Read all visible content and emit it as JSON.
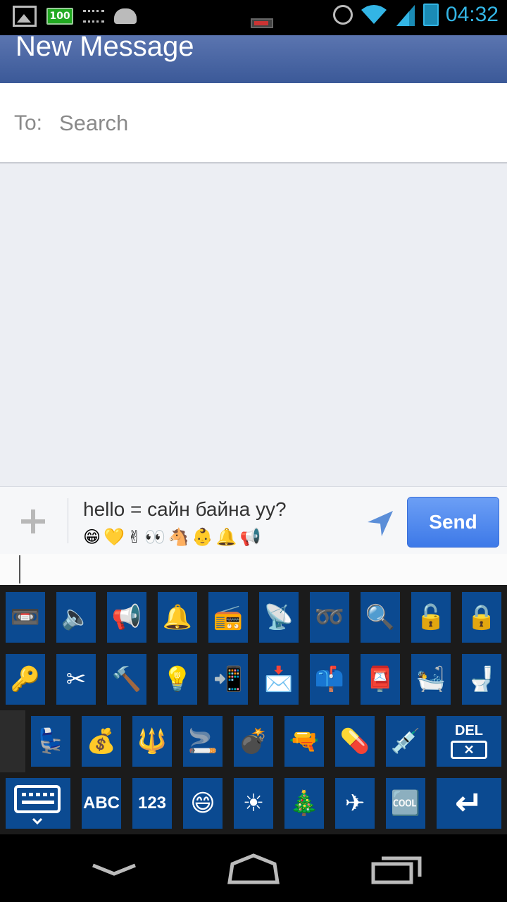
{
  "status_bar": {
    "battery_text": "100",
    "time": "04:32"
  },
  "header": {
    "title": "New Message"
  },
  "to_row": {
    "label": "To:",
    "placeholder": "Search"
  },
  "composer": {
    "message_text": "hello = сайн байна уу?",
    "emojis": [
      "😁",
      "💛",
      "✌",
      "👀",
      "🐴",
      "👶",
      "🔔",
      "📢"
    ],
    "send_label": "Send"
  },
  "keyboard": {
    "row1": [
      {
        "name": "videocassette-key",
        "glyph": "📼"
      },
      {
        "name": "speaker-key",
        "glyph": "🔈"
      },
      {
        "name": "megaphone-key",
        "glyph": "📢"
      },
      {
        "name": "bell-key",
        "glyph": "🔔"
      },
      {
        "name": "radio-key",
        "glyph": "📻"
      },
      {
        "name": "satellite-key",
        "glyph": "📡"
      },
      {
        "name": "loop-key",
        "glyph": "➿"
      },
      {
        "name": "magnifier-key",
        "glyph": "🔍"
      },
      {
        "name": "unlock-key",
        "glyph": "🔓"
      },
      {
        "name": "lock-key",
        "glyph": "🔒"
      }
    ],
    "row2": [
      {
        "name": "key-key",
        "glyph": "🔑"
      },
      {
        "name": "scissors-key",
        "glyph": "✂"
      },
      {
        "name": "hammer-key",
        "glyph": "🔨"
      },
      {
        "name": "light-bulb-key",
        "glyph": "💡"
      },
      {
        "name": "mobile-arrow-key",
        "glyph": "📲"
      },
      {
        "name": "envelope-arrow-key",
        "glyph": "📩"
      },
      {
        "name": "mailbox-key",
        "glyph": "📫"
      },
      {
        "name": "postbox-key",
        "glyph": "📮"
      },
      {
        "name": "bathtub-key",
        "glyph": "🛀"
      },
      {
        "name": "toilet-key",
        "glyph": "🚽"
      }
    ],
    "row3": [
      {
        "name": "seat-key",
        "glyph": "💺"
      },
      {
        "name": "money-bag-key",
        "glyph": "💰"
      },
      {
        "name": "trident-key",
        "glyph": "🔱"
      },
      {
        "name": "smoking-key",
        "glyph": "🚬"
      },
      {
        "name": "bomb-key",
        "glyph": "💣"
      },
      {
        "name": "gun-key",
        "glyph": "🔫"
      },
      {
        "name": "pill-key",
        "glyph": "💊"
      },
      {
        "name": "syringe-key",
        "glyph": "💉"
      }
    ],
    "del_label": "DEL",
    "del_box": "✕",
    "row4": [
      {
        "name": "abc-key",
        "label": "ABC"
      },
      {
        "name": "numbers-key",
        "label": "123"
      },
      {
        "name": "smile-key",
        "label": "😄"
      },
      {
        "name": "sun-key",
        "label": "☀"
      },
      {
        "name": "christmas-tree-key",
        "label": "🎄"
      },
      {
        "name": "airplane-key",
        "label": "✈"
      },
      {
        "name": "cool-key",
        "label": "🆒"
      }
    ],
    "enter_glyph": "↵"
  },
  "colors": {
    "header_blue": "#3b5998",
    "key_blue": "#0b4a91",
    "send_blue": "#3d79e8",
    "status_cyan": "#33b5e5"
  }
}
